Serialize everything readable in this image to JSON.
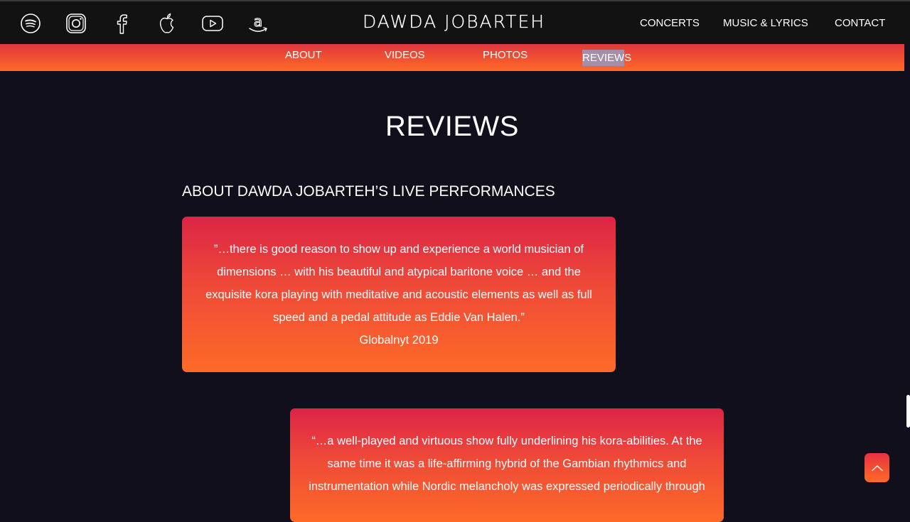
{
  "header": {
    "brand": "DAWDA JOBARTEH",
    "social_icons": [
      "spotify-icon",
      "instagram-icon",
      "facebook-icon",
      "apple-music-icon",
      "youtube-icon",
      "amazon-icon"
    ],
    "nav": {
      "concerts": "CONCERTS",
      "music_lyrics": "MUSIC & LYRICS",
      "contact": "CONTACT"
    }
  },
  "subnav": {
    "items": [
      "ABOUT",
      "VIDEOS",
      "PHOTOS",
      "REVIEWS"
    ],
    "active": "REVIEWS"
  },
  "main": {
    "title": "REVIEWS",
    "section_heading": "ABOUT DAWDA JOBARTEH’S LIVE PERFORMANCES",
    "reviews": [
      {
        "quote": "”…there is good reason to show up and experience a world musician of dimensions … with his beautiful and atypical baritone voice … and the exquisite kora playing with meditative and acoustic elements as well as full speed and a pedal attitude as Eddie Van Halen.”",
        "source": "Globalnyt 2019"
      },
      {
        "quote": "“…a well-played and virtuous show fully underlining his kora-abilities. At the same time it was a life-affirming hybrid of the Gambian rhythmics and instrumentation while Nordic melancholy was expressed periodically through",
        "source": ""
      }
    ]
  },
  "colors": {
    "background": "#110f1c",
    "header_bg": "#121212",
    "accent_top": "#dc2446",
    "accent_bottom": "#fe6a28",
    "active_tab_bg": "#a38fa8"
  },
  "back_to_top_icon": "chevron-up-icon"
}
